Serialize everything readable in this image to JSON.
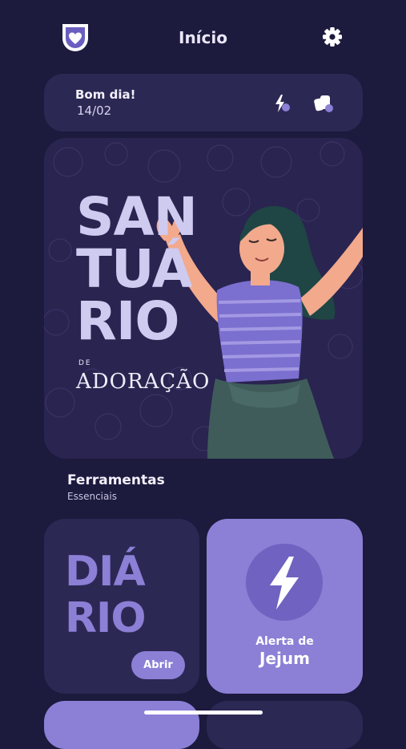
{
  "header": {
    "title": "Início",
    "logo_icon": "heart-shield-icon",
    "settings_icon": "gear-icon"
  },
  "greeting": {
    "title": "Bom dia!",
    "date": "14/02",
    "actions": [
      "bolt-icon",
      "cards-icon"
    ]
  },
  "banner": {
    "lines": [
      "SAN",
      "TUÁ",
      "RIO"
    ],
    "small": "DE",
    "subtitle": "ADORAÇÃO"
  },
  "tools": {
    "title": "Ferramentas",
    "subtitle": "Essenciais"
  },
  "diario": {
    "lines": [
      "DIÁ",
      "RIO"
    ],
    "button": "Abrir"
  },
  "jejum": {
    "line1": "Alerta de",
    "line2": "Jejum",
    "icon": "bolt-icon"
  },
  "colors": {
    "background": "#1c1a3d",
    "card": "#2c2854",
    "accent": "#8b7fd6"
  }
}
